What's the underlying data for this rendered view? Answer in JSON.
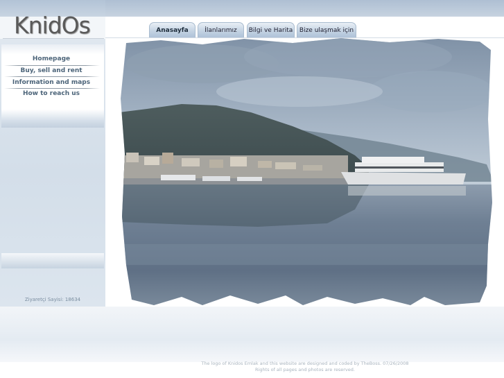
{
  "logo": {
    "text": "KnidOs"
  },
  "sidebar": {
    "items": [
      {
        "label": "Homepage"
      },
      {
        "label": "Buy, sell and rent"
      },
      {
        "label": "Information and maps"
      },
      {
        "label": "How to reach us"
      }
    ],
    "visitor_text": "Ziyaretçi Sayisi: 18634"
  },
  "tabs": [
    {
      "label": "Anasayfa",
      "active": true
    },
    {
      "label": "İlanlarımız",
      "active": false
    },
    {
      "label": "Bilgi ve Harita",
      "active": false
    },
    {
      "label": "Bize ulaşmak için",
      "active": false
    }
  ],
  "footer": {
    "line1": "The logo of Knidos Emlak and this website are designed and coded by TheBoss. 07/26/2008",
    "line2": "Rights of all pages and photos are reserved."
  },
  "colors": {
    "menu_text": "#4c6479",
    "banner_blue": "#b2c3d6",
    "tab_blue": "#c4d3e3"
  }
}
